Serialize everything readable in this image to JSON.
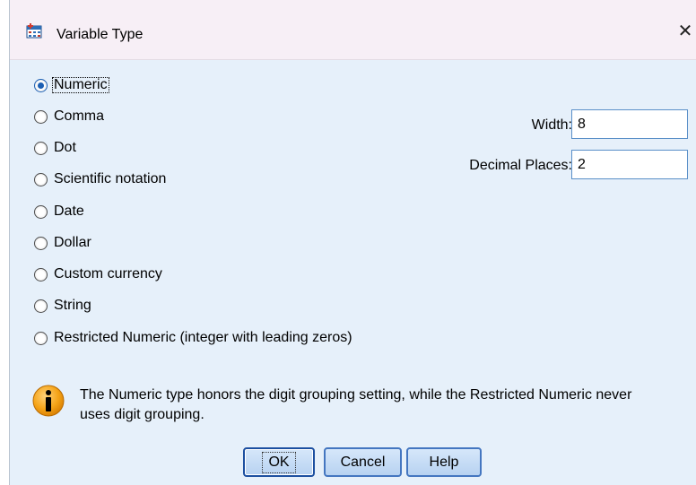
{
  "window": {
    "title": "Variable Type",
    "close_glyph": "✕"
  },
  "types": [
    {
      "label": "Numeric",
      "checked": true
    },
    {
      "label": "Comma",
      "checked": false
    },
    {
      "label": "Dot",
      "checked": false
    },
    {
      "label": "Scientific notation",
      "checked": false
    },
    {
      "label": "Date",
      "checked": false
    },
    {
      "label": "Dollar",
      "checked": false
    },
    {
      "label": "Custom currency",
      "checked": false
    },
    {
      "label": "String",
      "checked": false
    },
    {
      "label": "Restricted Numeric (integer with leading zeros)",
      "checked": false
    }
  ],
  "width": {
    "label": "Width:",
    "value": "8"
  },
  "decimals": {
    "label": "Decimal Places:",
    "value": "2"
  },
  "info": {
    "text": "The Numeric type honors the digit grouping setting, while the Restricted Numeric never uses digit grouping."
  },
  "buttons": {
    "ok": "OK",
    "cancel": "Cancel",
    "help": "Help"
  },
  "colors": {
    "accent": "#1c5fb3",
    "dialog_bg": "#e6f0fa",
    "titlebar_bg": "#f7eff6",
    "info_orange": "#f5a418"
  },
  "icons": {
    "app": "spss-data-icon",
    "info": "info-icon",
    "close": "close-icon"
  }
}
